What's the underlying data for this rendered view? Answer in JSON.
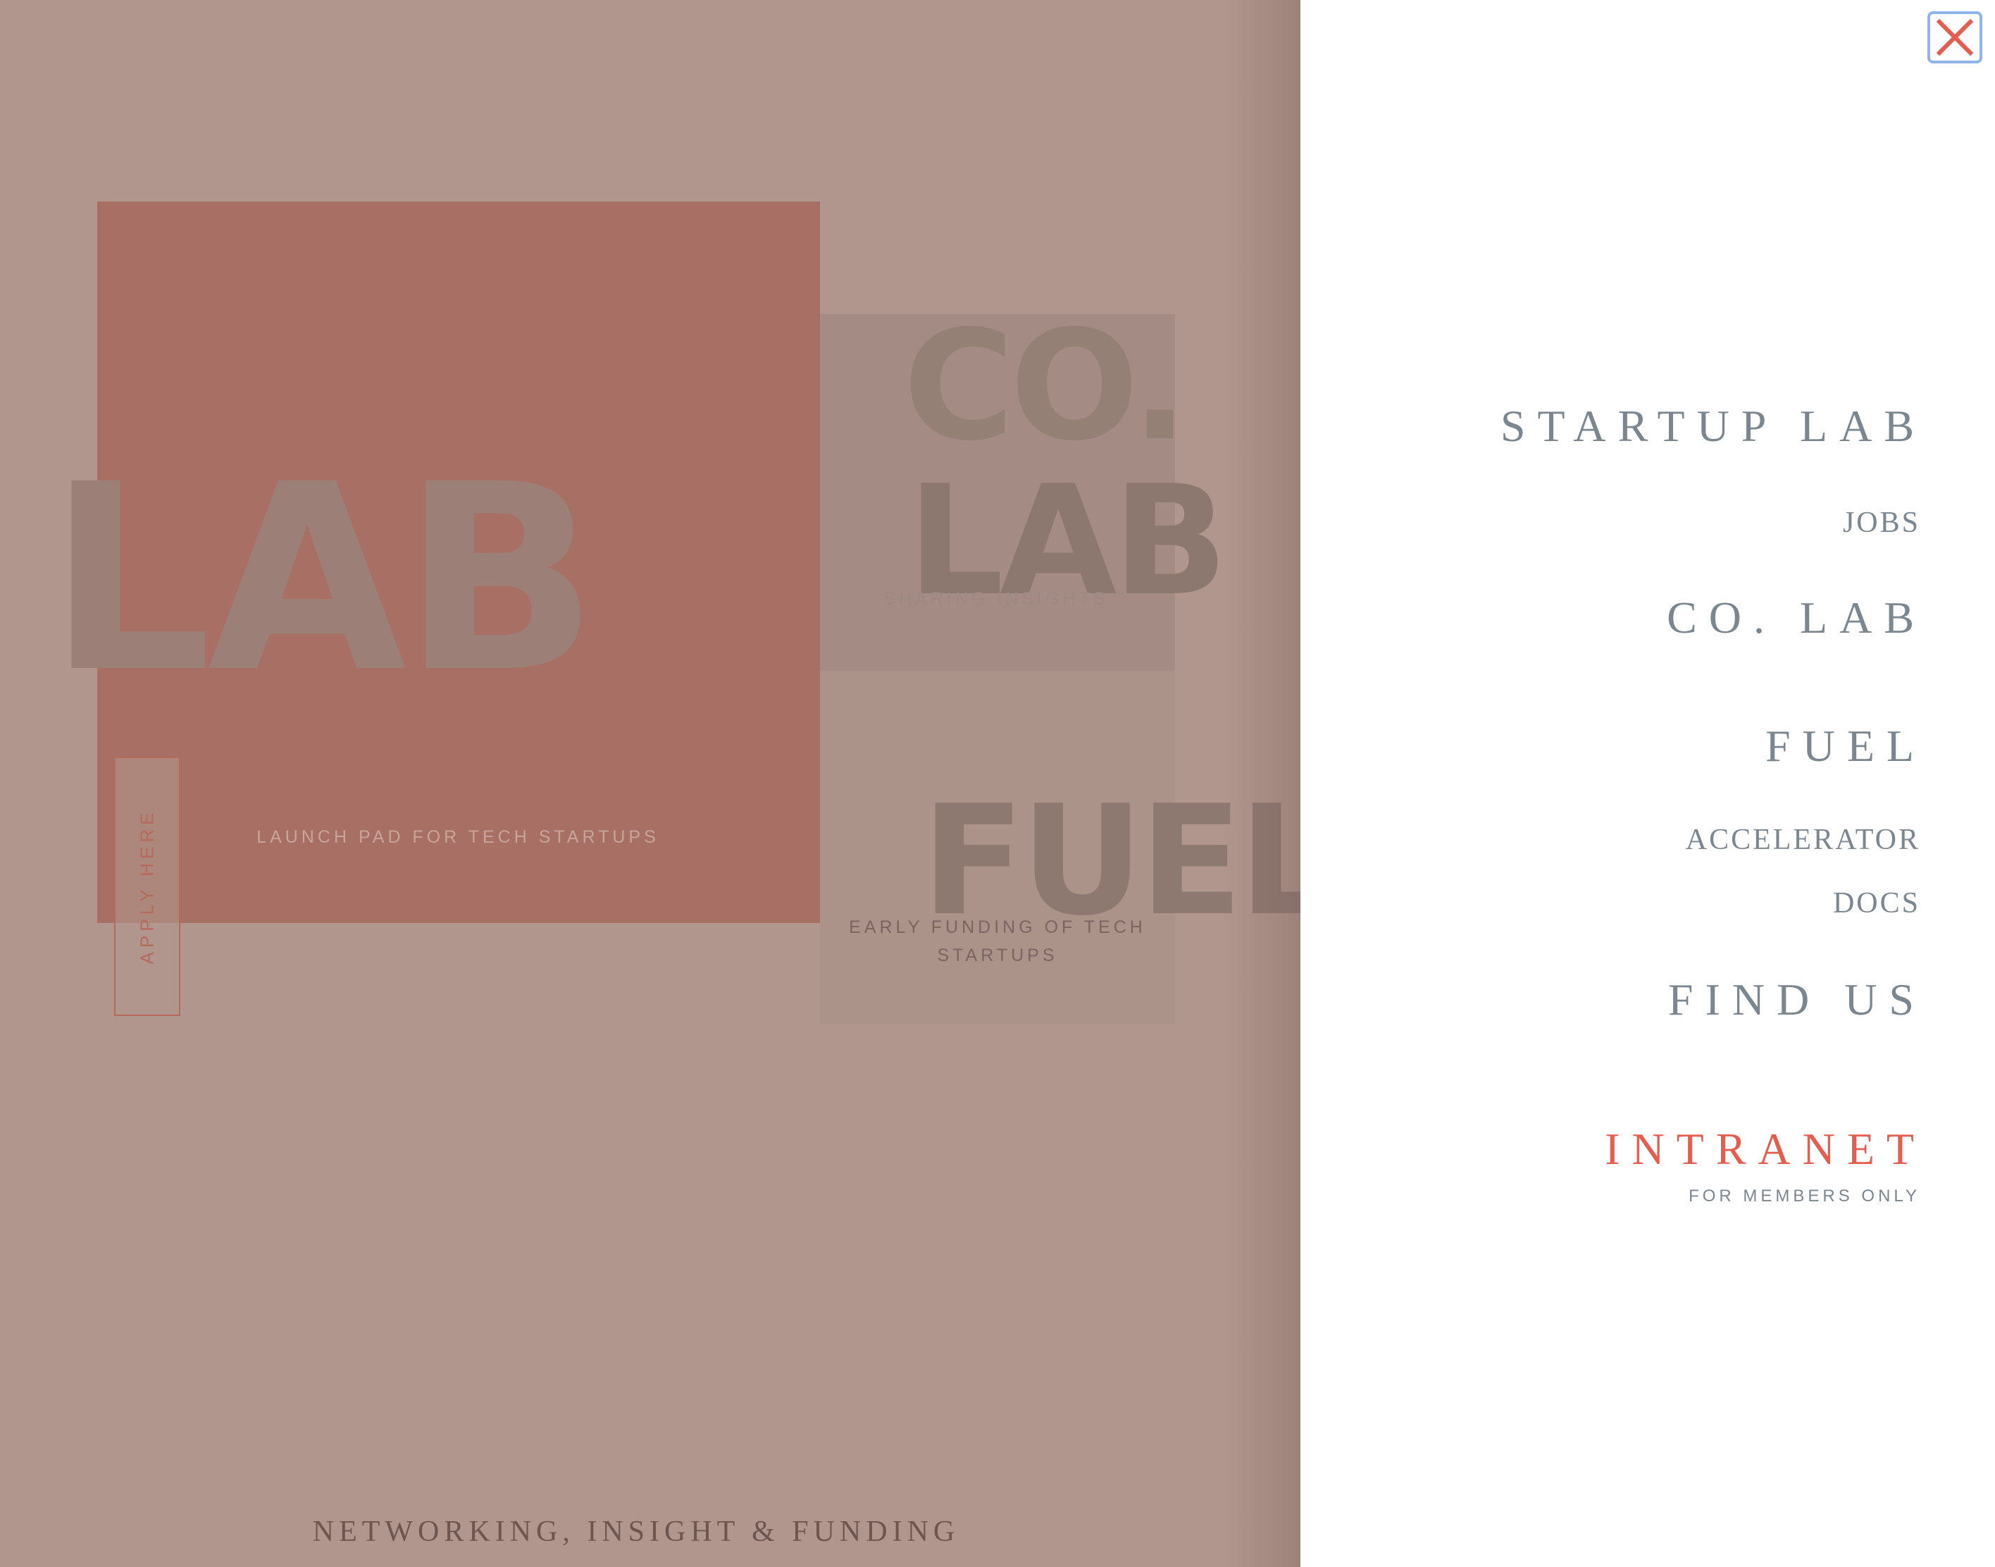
{
  "background": {
    "lab": {
      "word": "LAB",
      "caption": "LAUNCH PAD FOR TECH STARTUPS",
      "apply_label": "APPLY HERE"
    },
    "colab": {
      "word_top": "CO.",
      "word_bottom": "LAB",
      "caption": "SHARING INSIGHTS"
    },
    "fuel": {
      "word": "FUEL",
      "caption": "EARLY FUNDING OF TECH STARTUPS"
    },
    "tagline": "NETWORKING, INSIGHT & FUNDING"
  },
  "menu": {
    "close_icon": "close-icon",
    "items": {
      "startup_lab": "STARTUP LAB",
      "jobs": "JOBS",
      "colab": "CO. LAB",
      "fuel": "FUEL",
      "accelerator": "ACCELERATOR",
      "docs": "DOCS",
      "find_us": "FIND US",
      "intranet": "INTRANET",
      "intranet_note": "FOR MEMBERS ONLY"
    }
  },
  "colors": {
    "overlay": "#b0968c",
    "lab_card": "#a87064",
    "menu_text": "#7a8690",
    "accent": "#e45d4f",
    "close_border": "#8fb5ea"
  }
}
